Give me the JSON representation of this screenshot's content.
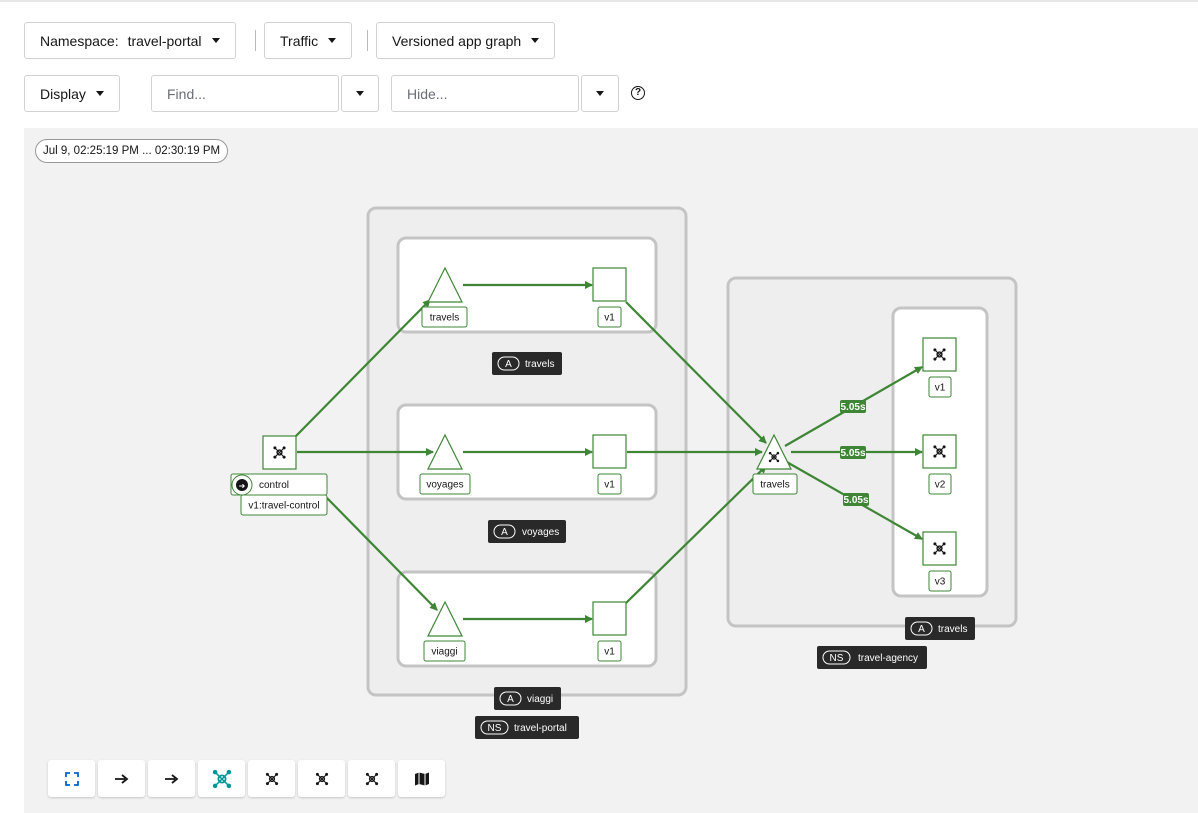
{
  "toolbar": {
    "namespace_label": "Namespace:",
    "namespace_value": "travel-portal",
    "traffic_label": "Traffic",
    "graph_type_label": "Versioned app graph",
    "display_label": "Display",
    "find_placeholder": "Find...",
    "hide_placeholder": "Hide...",
    "help_glyph": "?"
  },
  "graph": {
    "time_range": "Jul 9, 02:25:19 PM ... 02:30:19 PM",
    "colors": {
      "edge": "#3e8635",
      "box_border": "#c4c4c4",
      "label_dark": "#292929"
    },
    "boxes": {
      "app_travels": {
        "badge": "A",
        "label": "travels"
      },
      "app_voyages": {
        "badge": "A",
        "label": "voyages"
      },
      "app_viaggi": {
        "badge": "A",
        "label": "viaggi"
      },
      "ns_travel_portal": {
        "badge": "NS",
        "label": "travel-portal"
      },
      "app_travels_agency": {
        "badge": "A",
        "label": "travels"
      },
      "ns_travel_agency": {
        "badge": "NS",
        "label": "travel-agency"
      }
    },
    "nodes": {
      "control": {
        "label": "control",
        "version": "v1:travel-control",
        "entry_glyph": "➜"
      },
      "travels_service": {
        "label": "travels"
      },
      "travels_v1": {
        "label": "v1"
      },
      "voyages_service": {
        "label": "voyages"
      },
      "voyages_v1": {
        "label": "v1"
      },
      "viaggi_service": {
        "label": "viaggi"
      },
      "viaggi_v1": {
        "label": "v1"
      },
      "agency_travels_service": {
        "label": "travels"
      },
      "agency_v1": {
        "label": "v1"
      },
      "agency_v2": {
        "label": "v2"
      },
      "agency_v3": {
        "label": "v3"
      }
    },
    "edge_labels": {
      "to_v1": "5.05s",
      "to_v2": "5.05s",
      "to_v3": "5.05s"
    }
  },
  "graph_toolbar": {
    "buttons": [
      {
        "name": "fit-to-screen",
        "icon": "expand-icon"
      },
      {
        "name": "layout-left-right",
        "icon": "arrow-right-icon"
      },
      {
        "name": "layout-top-down",
        "icon": "arrow-right-icon"
      },
      {
        "name": "layout-default",
        "icon": "topology-icon"
      },
      {
        "name": "layout-1",
        "icon": "topology-icon"
      },
      {
        "name": "layout-2",
        "icon": "topology-icon"
      },
      {
        "name": "layout-3",
        "icon": "topology-icon"
      },
      {
        "name": "legend",
        "icon": "map-icon"
      }
    ]
  }
}
